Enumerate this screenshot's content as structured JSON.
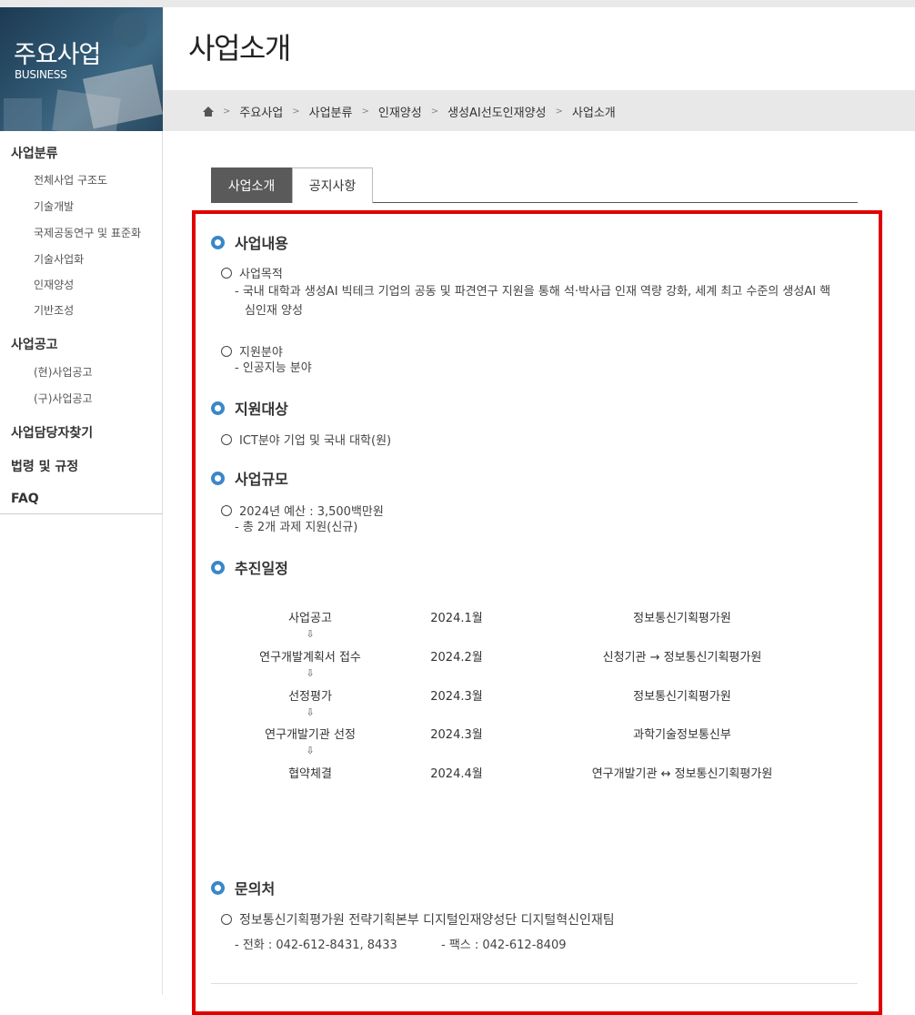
{
  "banner": {
    "title": "주요사업",
    "subtitle": "BUSINESS"
  },
  "page_title": "사업소개",
  "breadcrumb": [
    "주요사업",
    "사업분류",
    "인재양성",
    "생성AI선도인재양성",
    "사업소개"
  ],
  "breadcrumb_sep": ">",
  "leftnav": {
    "group1": {
      "title": "사업분류",
      "items": [
        "전체사업 구조도",
        "기술개발",
        "국제공동연구 및 표준화",
        "기술사업화",
        "인재양성",
        "기반조성"
      ]
    },
    "group2": {
      "title": "사업공고",
      "items": [
        "(현)사업공고",
        "(구)사업공고"
      ]
    },
    "other": [
      "사업담당자찾기",
      "법령 및 규정",
      "FAQ"
    ]
  },
  "tabs": [
    "사업소개",
    "공지사항"
  ],
  "sections": {
    "content": {
      "title": "사업내용",
      "purpose_label": "사업목적",
      "purpose_line1": "- 국내 대학과 생성AI 빅테크 기업의 공동 및 파견연구 지원을 통해 석·박사급 인재 역량 강화, 세계 최고 수준의 생성AI 핵",
      "purpose_line2": "심인재 양성",
      "field_label": "지원분야",
      "field_desc": "- 인공지능 분야"
    },
    "target": {
      "title": "지원대상",
      "item": "ICT분야 기업 및 국내 대학(원)"
    },
    "scale": {
      "title": "사업규모",
      "item": "2024년 예산 : 3,500백만원",
      "desc": "- 총 2개 과제 지원(신규)"
    },
    "schedule": {
      "title": "추진일정",
      "arrow": "⇩",
      "rows": [
        {
          "step": "사업공고",
          "date": "2024.1월",
          "org": "정보통신기획평가원"
        },
        {
          "step": "연구개발계획서 접수",
          "date": "2024.2월",
          "org": "신청기관 → 정보통신기획평가원"
        },
        {
          "step": "선정평가",
          "date": "2024.3월",
          "org": "정보통신기획평가원"
        },
        {
          "step": "연구개발기관 선정",
          "date": "2024.3월",
          "org": "과학기술정보통신부"
        },
        {
          "step": "협약체결",
          "date": "2024.4월",
          "org": "연구개발기관 ↔ 정보통신기획평가원"
        }
      ]
    },
    "contact": {
      "title": "문의처",
      "item": "정보통신기획평가원 전략기획본부 디지털인재양성단 디지털혁신인재팀",
      "phone": "- 전화 : 042-612-8431, 8433",
      "fax": "- 팩스 : 042-612-8409"
    }
  },
  "colors": {
    "accent_ring": "#3a87c8",
    "highlight_border": "#e00000",
    "active_tab": "#5a5a5a"
  }
}
